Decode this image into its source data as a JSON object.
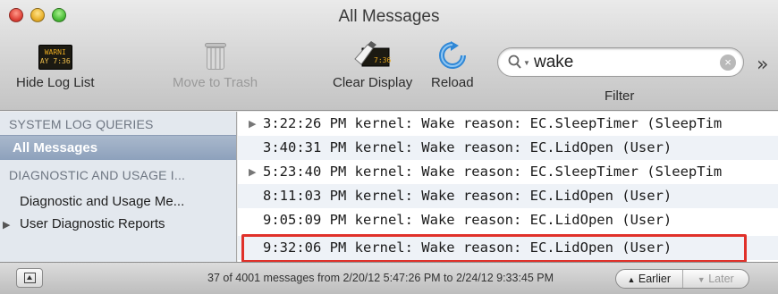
{
  "window": {
    "title": "All Messages"
  },
  "toolbar": {
    "hide_log_list": "Hide Log List",
    "console_icon_line1": "WARNI",
    "console_icon_line2": "AY 7:36",
    "move_to_trash": "Move to Trash",
    "clear_display": "Clear Display",
    "clear_icon_text": "7:36",
    "reload": "Reload",
    "filter_label": "Filter",
    "overflow": "»"
  },
  "search": {
    "value": "wake"
  },
  "sidebar": {
    "section1_header": "SYSTEM LOG QUERIES",
    "selected_item": "All Messages",
    "section2_header": "DIAGNOSTIC AND USAGE I...",
    "item_diagnostic_usage": "Diagnostic and Usage Me...",
    "item_user_reports": "User Diagnostic Reports"
  },
  "log": {
    "rows": [
      {
        "text": "3:22:26 PM kernel: Wake reason: EC.SleepTimer (SleepTim",
        "expandable": true
      },
      {
        "text": "3:40:31 PM kernel: Wake reason: EC.LidOpen (User)",
        "expandable": false
      },
      {
        "text": "5:23:40 PM kernel: Wake reason: EC.SleepTimer (SleepTim",
        "expandable": true
      },
      {
        "text": "8:11:03 PM kernel: Wake reason: EC.LidOpen (User)",
        "expandable": false
      },
      {
        "text": "9:05:09 PM kernel: Wake reason: EC.LidOpen (User)",
        "expandable": false
      },
      {
        "text": "9:32:06 PM kernel: Wake reason: EC.LidOpen (User)",
        "expandable": false
      }
    ],
    "highlight_color": "#e0312a"
  },
  "bottombar": {
    "status": "37 of 4001 messages from 2/20/12 5:47:26 PM to 2/24/12 9:33:45 PM",
    "earlier": "Earlier",
    "later": "Later"
  },
  "colors": {
    "selection": "#8da1bc",
    "sidebar_bg": "#e3e8ee"
  }
}
